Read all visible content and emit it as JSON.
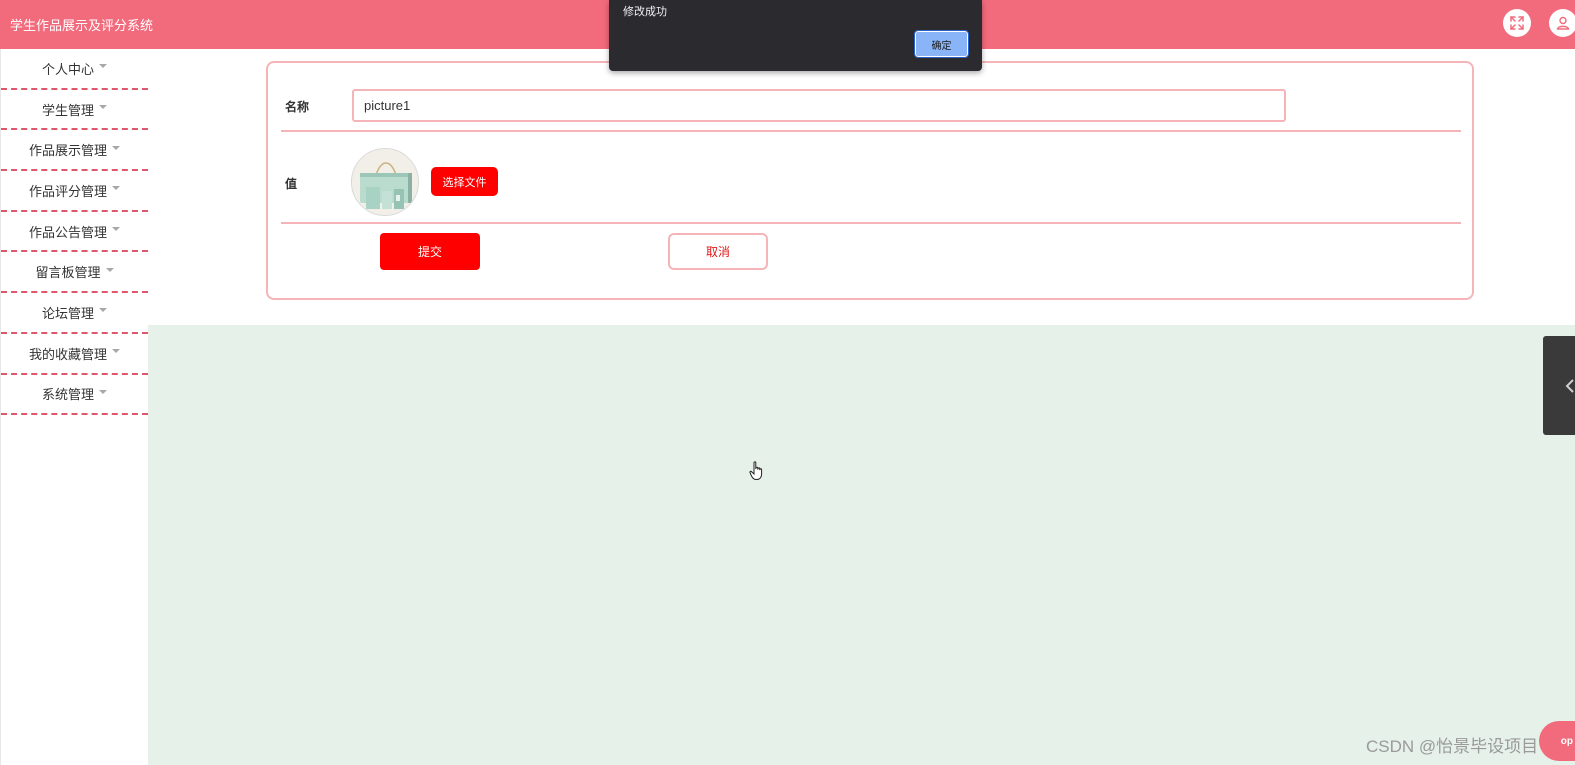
{
  "header": {
    "title": "学生作品展示及评分系统",
    "fullscreen_icon": "fullscreen-icon",
    "user_icon": "user-icon"
  },
  "sidebar": {
    "items": [
      {
        "label": "个人中心"
      },
      {
        "label": "学生管理"
      },
      {
        "label": "作品展示管理"
      },
      {
        "label": "作品评分管理"
      },
      {
        "label": "作品公告管理"
      },
      {
        "label": "留言板管理"
      },
      {
        "label": "论坛管理"
      },
      {
        "label": "我的收藏管理"
      },
      {
        "label": "系统管理"
      }
    ]
  },
  "form": {
    "name_label": "名称",
    "name_value": "picture1",
    "value_label": "值",
    "choose_file_label": "选择文件",
    "submit_label": "提交",
    "cancel_label": "取消"
  },
  "alert": {
    "message": "修改成功",
    "ok_label": "确定"
  },
  "watermark": {
    "text": "CSDN @怡景毕设项目",
    "top_badge": "op"
  },
  "colors": {
    "header": "#f26b7d",
    "accent_red": "#ff0000",
    "border_pink": "#f5b5b8",
    "content_bg": "#e6f1ea",
    "dialog_bg": "#2b2a2f",
    "dialog_button": "#8ab4f8"
  }
}
